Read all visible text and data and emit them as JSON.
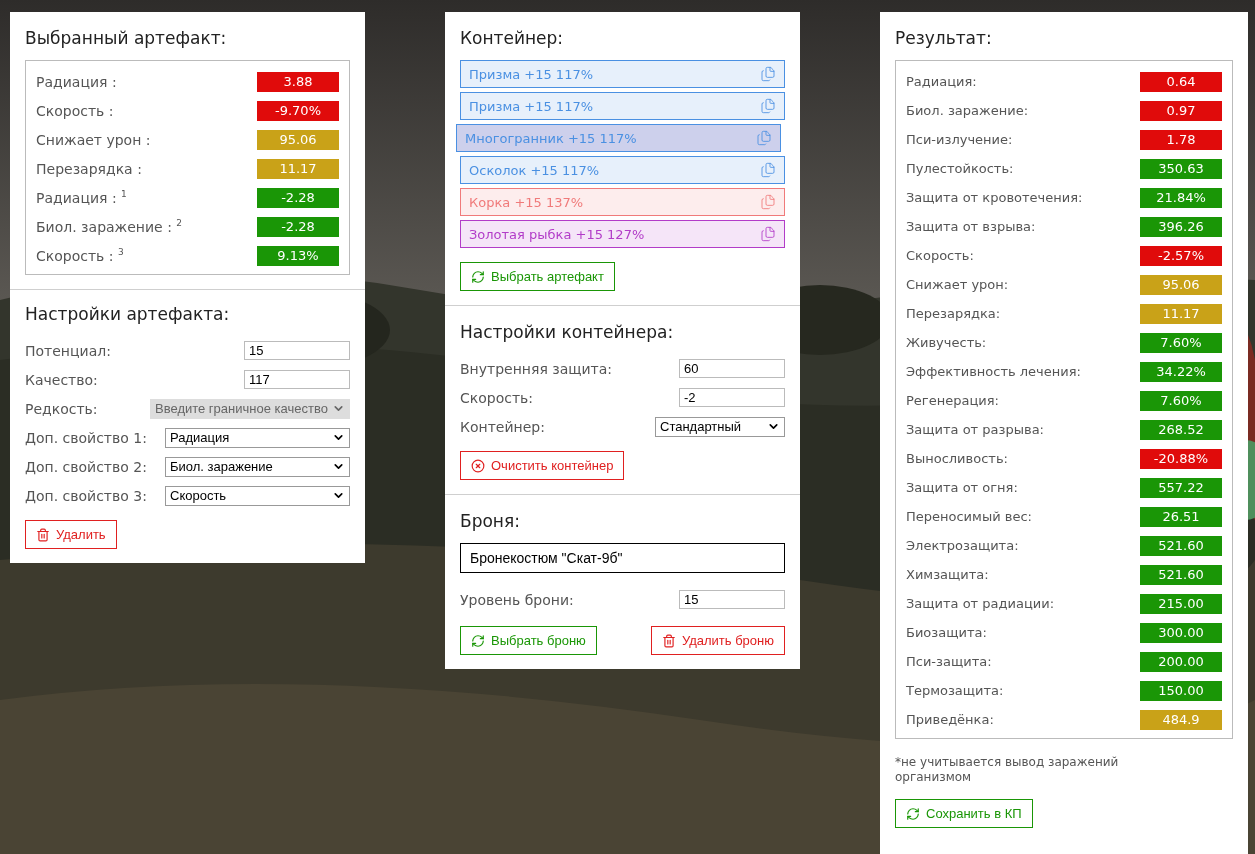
{
  "artifact_panel": {
    "title": "Выбранный артефакт:",
    "stats": [
      {
        "label": "Радиация :",
        "value": "3.88",
        "color": "#e00b0b"
      },
      {
        "label": "Скорость :",
        "value": "-9.70%",
        "color": "#e00b0b"
      },
      {
        "label": "Снижает урон :",
        "value": "95.06",
        "color": "#c9a218"
      },
      {
        "label": "Перезарядка :",
        "value": "11.17",
        "color": "#c9a218"
      },
      {
        "label": "Радиация : $^{1}$",
        "value": "-2.28",
        "color": "#1a9606"
      },
      {
        "label": "Биол. заражение : $^{2}$",
        "value": "-2.28",
        "color": "#1a9606"
      },
      {
        "label": "Скорость : $^{3}$",
        "value": "9.13%",
        "color": "#1a9606"
      }
    ],
    "settings_title": "Настройки артефакта:",
    "fields": [
      {
        "kind": "input",
        "label": "Потенциал:",
        "value": "15"
      },
      {
        "kind": "input",
        "label": "Качество:",
        "value": "117"
      },
      {
        "kind": "select",
        "label": "Редкость:",
        "value": "Введите граничное качество",
        "disabled": true
      },
      {
        "kind": "select",
        "label": "Доп. свойство 1:",
        "value": "Радиация",
        "disabled": false
      },
      {
        "kind": "select",
        "label": "Доп. свойство 2:",
        "value": "Биол. заражение",
        "disabled": false
      },
      {
        "kind": "select",
        "label": "Доп. свойство 3:",
        "value": "Скорость",
        "disabled": false
      }
    ],
    "delete_button": "Удалить"
  },
  "container_panel": {
    "title": "Контейнер:",
    "items": [
      {
        "label": "Призма +15 117%",
        "color": "#4a90e2",
        "selected": false
      },
      {
        "label": "Призма +15 117%",
        "color": "#4a90e2",
        "selected": false
      },
      {
        "label": "Многогранник +15 117%",
        "color": "#4a90e2",
        "selected": true
      },
      {
        "label": "Осколок +15 117%",
        "color": "#4a90e2",
        "selected": false
      },
      {
        "label": "Корка +15 137%",
        "color": "#f07a7a",
        "selected": false
      },
      {
        "label": "Золотая рыбка +15 127%",
        "color": "#b23cc8",
        "selected": false
      }
    ],
    "choose_button": "Выбрать артефакт",
    "settings_title": "Настройки контейнера:",
    "fields": [
      {
        "kind": "input",
        "label": "Внутренняя защита:",
        "value": "60"
      },
      {
        "kind": "input",
        "label": "Скорость:",
        "value": "-2"
      },
      {
        "kind": "select",
        "label": "Контейнер:",
        "value": "Стандартный",
        "disabled": false
      }
    ],
    "clear_button": "Очистить контейнер",
    "armor_title": "Броня:",
    "armor_name": "Бронекостюм \"Скат-9б\"",
    "armor_level_label": "Уровень брони:",
    "armor_level": "15",
    "choose_armor_button": "Выбрать броню",
    "delete_armor_button": "Удалить броню"
  },
  "result_panel": {
    "title": "Результат:",
    "stats": [
      {
        "label": "Радиация:",
        "value": "0.64",
        "color": "#e00b0b"
      },
      {
        "label": "Биол. заражение:",
        "value": "0.97",
        "color": "#e00b0b"
      },
      {
        "label": "Пси-излучение:",
        "value": "1.78",
        "color": "#e00b0b"
      },
      {
        "label": "Пулестойкость:",
        "value": "350.63",
        "color": "#1a9606"
      },
      {
        "label": "Защита от кровотечения:",
        "value": "21.84%",
        "color": "#1a9606"
      },
      {
        "label": "Защита от взрыва:",
        "value": "396.26",
        "color": "#1a9606"
      },
      {
        "label": "Скорость:",
        "value": "-2.57%",
        "color": "#e00b0b"
      },
      {
        "label": "Снижает урон:",
        "value": "95.06",
        "color": "#c9a218"
      },
      {
        "label": "Перезарядка:",
        "value": "11.17",
        "color": "#c9a218"
      },
      {
        "label": "Живучесть:",
        "value": "7.60%",
        "color": "#1a9606"
      },
      {
        "label": "Эффективность лечения:",
        "value": "34.22%",
        "color": "#1a9606"
      },
      {
        "label": "Регенерация:",
        "value": "7.60%",
        "color": "#1a9606"
      },
      {
        "label": "Защита от разрыва:",
        "value": "268.52",
        "color": "#1a9606"
      },
      {
        "label": "Выносливость:",
        "value": "-20.88%",
        "color": "#e00b0b"
      },
      {
        "label": "Защита от огня:",
        "value": "557.22",
        "color": "#1a9606"
      },
      {
        "label": "Переносимый вес:",
        "value": "26.51",
        "color": "#1a9606"
      },
      {
        "label": "Электрозащита:",
        "value": "521.60",
        "color": "#1a9606"
      },
      {
        "label": "Химзащита:",
        "value": "521.60",
        "color": "#1a9606"
      },
      {
        "label": "Защита от радиации:",
        "value": "215.00",
        "color": "#1a9606"
      },
      {
        "label": "Биозащита:",
        "value": "300.00",
        "color": "#1a9606"
      },
      {
        "label": "Пси-защита:",
        "value": "200.00",
        "color": "#1a9606"
      },
      {
        "label": "Термозащита:",
        "value": "150.00",
        "color": "#1a9606"
      },
      {
        "label": "Приведёнка:",
        "value": "484.9",
        "color": "#c9a218"
      }
    ],
    "note": "*не учитывается вывод заражений организмом",
    "save_button": "Сохранить в КП"
  }
}
